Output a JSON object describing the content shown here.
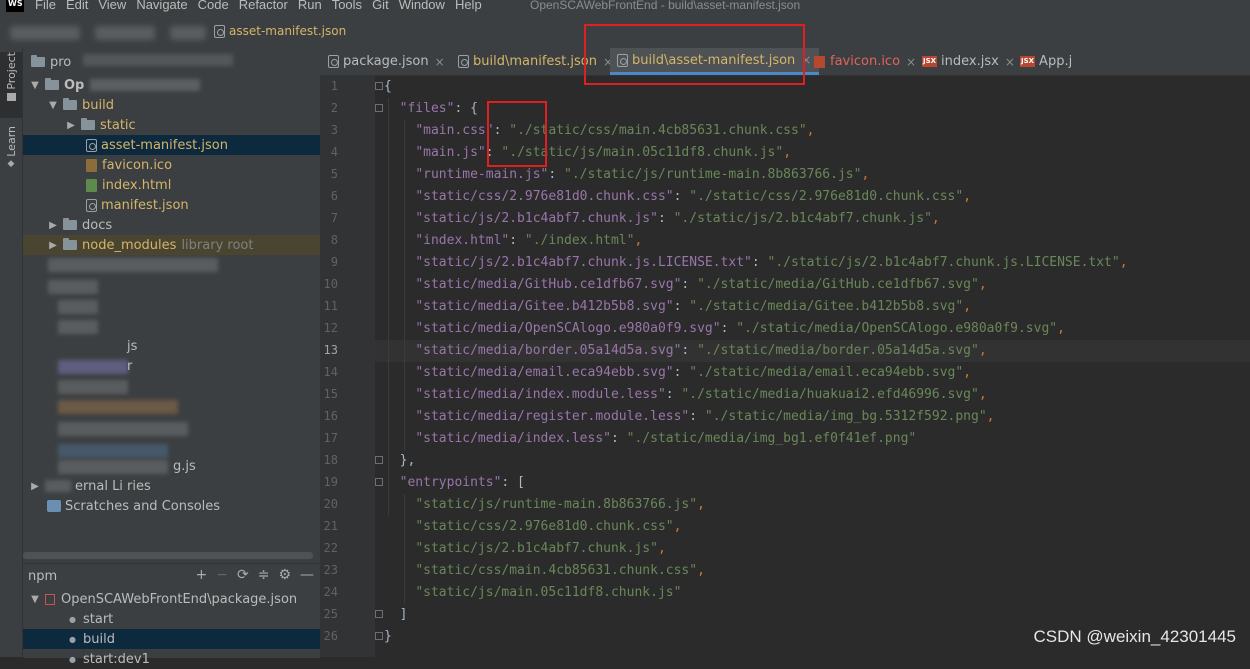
{
  "menubar": {
    "logo": "WS",
    "items": [
      "File",
      "Edit",
      "View",
      "Navigate",
      "Code",
      "Refactor",
      "Run",
      "Tools",
      "Git",
      "Window",
      "Help"
    ],
    "title": "OpenSCAWebFrontEnd - build\\asset-manifest.json"
  },
  "navbar": {
    "breadcrumb": "asset-manifest.json"
  },
  "toolstrip": {
    "project": "Project",
    "learn": "Learn"
  },
  "project": {
    "root_short": "pro",
    "root_o": "Op",
    "items": {
      "build": "build",
      "static": "static",
      "asset_manifest": "asset-manifest.json",
      "favicon": "favicon.ico",
      "index_html": "index.html",
      "manifest": "manifest.json",
      "docs": "docs",
      "node_modules": "node_modules",
      "library_root": "library root",
      "js_item": "js",
      "r_item": "r",
      "g_js_item": "g.js",
      "external_libs": "ernal Li  ries",
      "scratches": "Scratches and Consoles"
    }
  },
  "npm": {
    "title": "npm",
    "package": "OpenSCAWebFrontEnd\\package.json",
    "scripts": [
      "start",
      "build",
      "start:dev1"
    ]
  },
  "tabs": [
    {
      "label": "package.json",
      "color": "#bbbbbb"
    },
    {
      "label": "build\\manifest.json",
      "color": "#d4b56a"
    },
    {
      "label": "build\\asset-manifest.json",
      "color": "#d4b56a",
      "active": true
    },
    {
      "label": "favicon.ico",
      "color": "#e0635b"
    },
    {
      "label": "index.jsx",
      "color": "#bbbbbb"
    },
    {
      "label": "App.j",
      "color": "#bbbbbb"
    }
  ],
  "gutter": {
    "lines": [
      "1",
      "2",
      "3",
      "4",
      "5",
      "6",
      "7",
      "8",
      "9",
      "10",
      "11",
      "12",
      "13",
      "14",
      "15",
      "16",
      "17",
      "18",
      "19",
      "20",
      "21",
      "22",
      "23",
      "24",
      "25",
      "26"
    ],
    "current": "13"
  },
  "code": {
    "open": "{",
    "files_key": "\"files\"",
    "files": [
      [
        "\"main.css\"",
        "\"./static/css/main.4cb85631.chunk.css\""
      ],
      [
        "\"main.js\"",
        "\"./static/js/main.05c11df8.chunk.js\""
      ],
      [
        "\"runtime-main.js\"",
        "\"./static/js/runtime-main.8b863766.js\""
      ],
      [
        "\"static/css/2.976e81d0.chunk.css\"",
        "\"./static/css/2.976e81d0.chunk.css\""
      ],
      [
        "\"static/js/2.b1c4abf7.chunk.js\"",
        "\"./static/js/2.b1c4abf7.chunk.js\""
      ],
      [
        "\"index.html\"",
        "\"./index.html\""
      ],
      [
        "\"static/js/2.b1c4abf7.chunk.js.LICENSE.txt\"",
        "\"./static/js/2.b1c4abf7.chunk.js.LICENSE.txt\""
      ],
      [
        "\"static/media/GitHub.ce1dfb67.svg\"",
        "\"./static/media/GitHub.ce1dfb67.svg\""
      ],
      [
        "\"static/media/Gitee.b412b5b8.svg\"",
        "\"./static/media/Gitee.b412b5b8.svg\""
      ],
      [
        "\"static/media/OpenSCAlogo.e980a0f9.svg\"",
        "\"./static/media/OpenSCAlogo.e980a0f9.svg\""
      ],
      [
        "\"static/media/border.05a14d5a.svg\"",
        "\"./static/media/border.05a14d5a.svg\""
      ],
      [
        "\"static/media/email.eca94ebb.svg\"",
        "\"./static/media/email.eca94ebb.svg\""
      ],
      [
        "\"static/media/index.module.less\"",
        "\"./static/media/huakuai2.efd46996.svg\""
      ],
      [
        "\"static/media/register.module.less\"",
        "\"./static/media/img_bg.5312f592.png\""
      ],
      [
        "\"static/media/index.less\"",
        "\"./static/media/img_bg1.ef0f41ef.png\""
      ]
    ],
    "files_close": "},",
    "entrypoints_key": "\"entrypoints\"",
    "entrypoints": [
      "\"static/js/runtime-main.8b863766.js\"",
      "\"static/css/2.976e81d0.chunk.css\"",
      "\"static/js/2.b1c4abf7.chunk.js\"",
      "\"static/css/main.4cb85631.chunk.css\"",
      "\"static/js/main.05c11df8.chunk.js\""
    ],
    "entry_close": "]",
    "close": "}"
  },
  "watermark": "CSDN @weixin_42301445"
}
